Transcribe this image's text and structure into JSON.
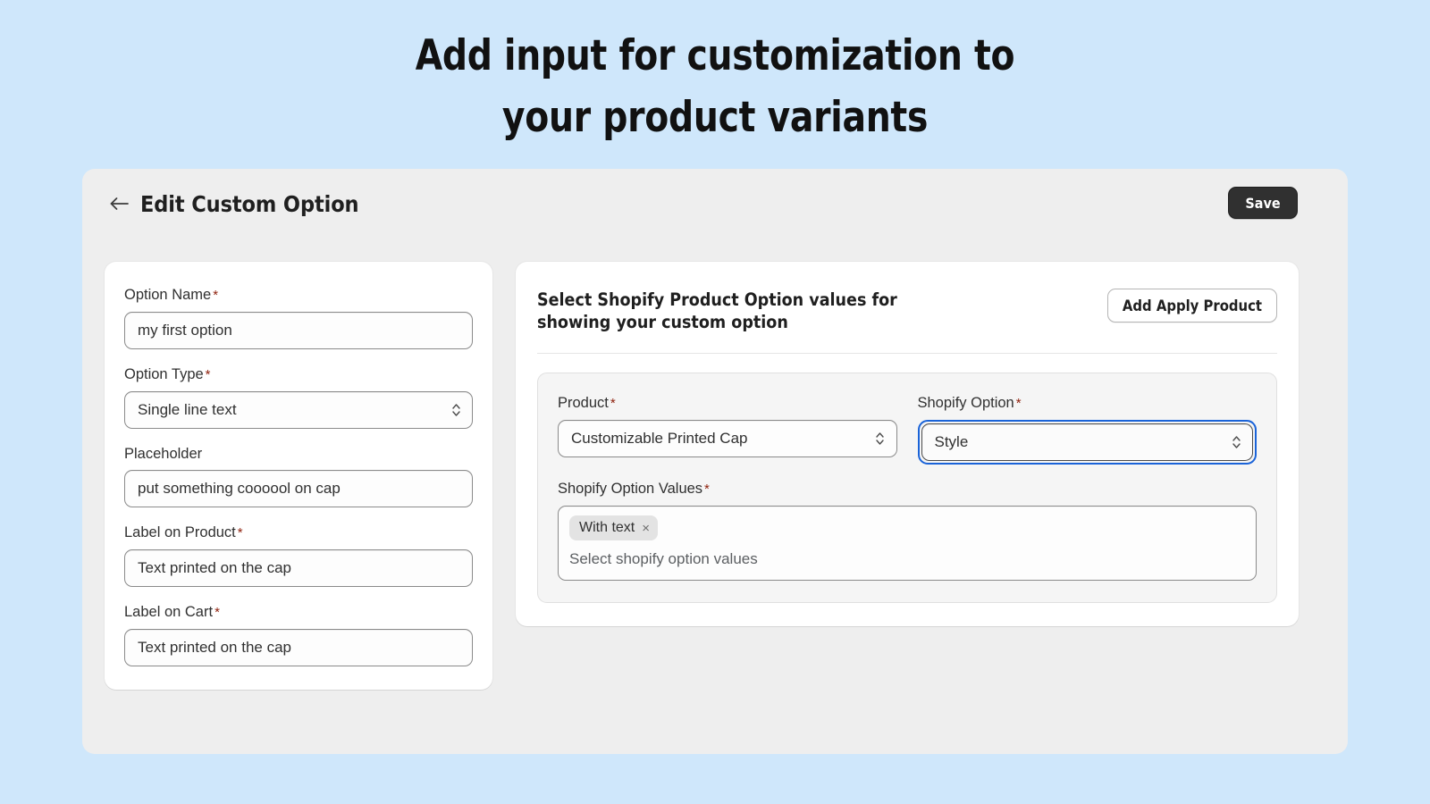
{
  "hero": {
    "line1": "Add input for customization to",
    "line2": "your product variants"
  },
  "colors": {
    "page_background": "#cfe7fb",
    "app_background": "#eeeeee",
    "card_background": "#ffffff",
    "inner_card_background": "#f5f5f5",
    "focus_ring": "#1a63d8",
    "required_asterisk": "#8e1f0b",
    "save_button_background": "#303030",
    "chip_background": "#e3e3e3"
  },
  "header": {
    "back_icon": "arrow-left-icon",
    "title": "Edit Custom Option",
    "save_label": "Save"
  },
  "left_panel": {
    "fields": [
      {
        "label": "Option Name",
        "required": true,
        "type": "text",
        "value": "my first option"
      },
      {
        "label": "Option Type",
        "required": true,
        "type": "select",
        "value": "Single line text"
      },
      {
        "label": "Placeholder",
        "required": false,
        "type": "text",
        "value": "put something coooool on cap"
      },
      {
        "label": "Label on Product",
        "required": true,
        "type": "text",
        "value": "Text printed on the cap"
      },
      {
        "label": "Label on Cart",
        "required": true,
        "type": "text",
        "value": "Text printed on the cap"
      }
    ]
  },
  "right_panel": {
    "title_line1": "Select Shopify Product Option values for",
    "title_line2": "showing your custom option",
    "add_product_label": "Add Apply Product",
    "product": {
      "label": "Product",
      "required": true,
      "value": "Customizable Printed Cap"
    },
    "shopify_option": {
      "label": "Shopify Option",
      "required": true,
      "value": "Style",
      "focused": true
    },
    "option_values": {
      "label": "Shopify Option Values",
      "required": true,
      "chips": [
        "With text"
      ],
      "chip_remove_icon": "close-icon",
      "placeholder": "Select shopify option values"
    }
  },
  "icons": {
    "required_mark": "*",
    "select_stepper": "chevron-up-down-icon",
    "chip_close": "×"
  }
}
